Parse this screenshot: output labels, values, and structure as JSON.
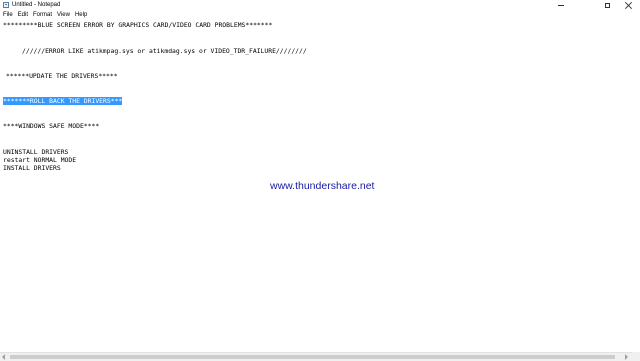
{
  "window": {
    "title": "Untitled - Notepad",
    "icon": "notepad-icon",
    "controls": {
      "minimize_icon": "minimize-icon",
      "maximize_icon": "maximize-icon",
      "close_icon": "close-icon"
    }
  },
  "menu": {
    "items": [
      "File",
      "Edit",
      "Format",
      "View",
      "Help"
    ]
  },
  "editor": {
    "lines": [
      "*********BLUE SCREEN ERROR BY GRAPHICS CARD/VIDEO CARD PROBLEMS*******",
      "//////ERROR LIKE atikmpag.sys or atikmdag.sys or VIDEO_TDR_FAILURE////////",
      "******UPDATE THE DRIVERS*****",
      "*******ROLL BACK THE DRIVERS***",
      "****WINDOWS SAFE MODE****",
      "UNINSTALL DRIVERS",
      "restart NORMAL MODE",
      "INSTALL DRIVERS"
    ],
    "selected_line_index": 3
  },
  "watermark": {
    "text": "www.thundershare.net",
    "color": "#1a1aa6"
  },
  "colors": {
    "selection": "#3399ff",
    "background": "#ffffff"
  }
}
